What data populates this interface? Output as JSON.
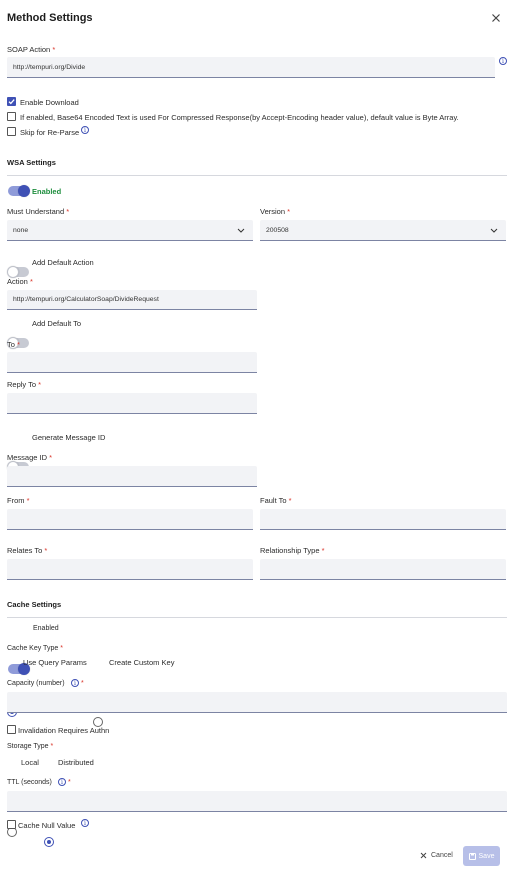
{
  "dialog": {
    "title": "Method Settings"
  },
  "soap_action": {
    "label": "SOAP Action",
    "required": "*",
    "value": "http://tempuri.org/Divide"
  },
  "enable_download": {
    "label": "Enable Download",
    "checked": true
  },
  "base64_option": {
    "label": "If enabled, Base64 Encoded Text is used For Compressed Response(by Accept-Encoding header value), default value is Byte Array.",
    "checked": false
  },
  "skip_reparse": {
    "label": "Skip for Re-Parse",
    "checked": false
  },
  "wsa": {
    "section_title": "WSA Settings",
    "enabled_label": "Enabled",
    "enabled": true,
    "must_understand": {
      "label": "Must Understand",
      "required": "*",
      "value": "none"
    },
    "version": {
      "label": "Version",
      "required": "*",
      "value": "200508"
    },
    "add_default_action": {
      "label": "Add Default Action",
      "on": false
    },
    "action": {
      "label": "Action",
      "required": "*",
      "value": "http://tempuri.org/CalculatorSoap/DivideRequest"
    },
    "add_default_to": {
      "label": "Add Default To",
      "on": false
    },
    "to": {
      "label": "To",
      "required": "*",
      "value": ""
    },
    "reply_to": {
      "label": "Reply To",
      "required": "*",
      "value": ""
    },
    "generate_message_id": {
      "label": "Generate Message ID",
      "on": false
    },
    "message_id": {
      "label": "Message ID",
      "required": "*",
      "value": ""
    },
    "from": {
      "label": "From",
      "required": "*",
      "value": ""
    },
    "fault_to": {
      "label": "Fault To",
      "required": "*",
      "value": ""
    },
    "relates_to": {
      "label": "Relates To",
      "required": "*",
      "value": ""
    },
    "relationship_type": {
      "label": "Relationship Type",
      "required": "*",
      "value": ""
    }
  },
  "cache": {
    "section_title": "Cache Settings",
    "enabled_label": "Enabled",
    "enabled": true,
    "key_type": {
      "label": "Cache Key Type",
      "required": "*",
      "options": [
        "Use Query Params",
        "Create Custom Key"
      ],
      "selected": "Use Query Params"
    },
    "capacity": {
      "label": "Capacity (number)",
      "required": "*",
      "value": ""
    },
    "invalidation": {
      "label": "Invalidation Requires Authn",
      "checked": false
    },
    "storage_type": {
      "label": "Storage Type",
      "required": "*",
      "options": [
        "Local",
        "Distributed"
      ],
      "selected": "Distributed"
    },
    "ttl": {
      "label": "TTL (seconds)",
      "required": "*",
      "value": ""
    },
    "cache_null": {
      "label": "Cache Null Value",
      "checked": false
    }
  },
  "footer": {
    "cancel_label": "Cancel",
    "save_label": "Save"
  },
  "icons": {
    "close": "close-icon",
    "info": "info-icon",
    "chevron": "chevron-down-icon",
    "check": "check-icon",
    "save": "save-icon"
  },
  "colors": {
    "accent": "#3f51b5",
    "enabled_green": "#1e8e3e",
    "required": "#d93025",
    "save_disabled": "#b7bfe8"
  }
}
